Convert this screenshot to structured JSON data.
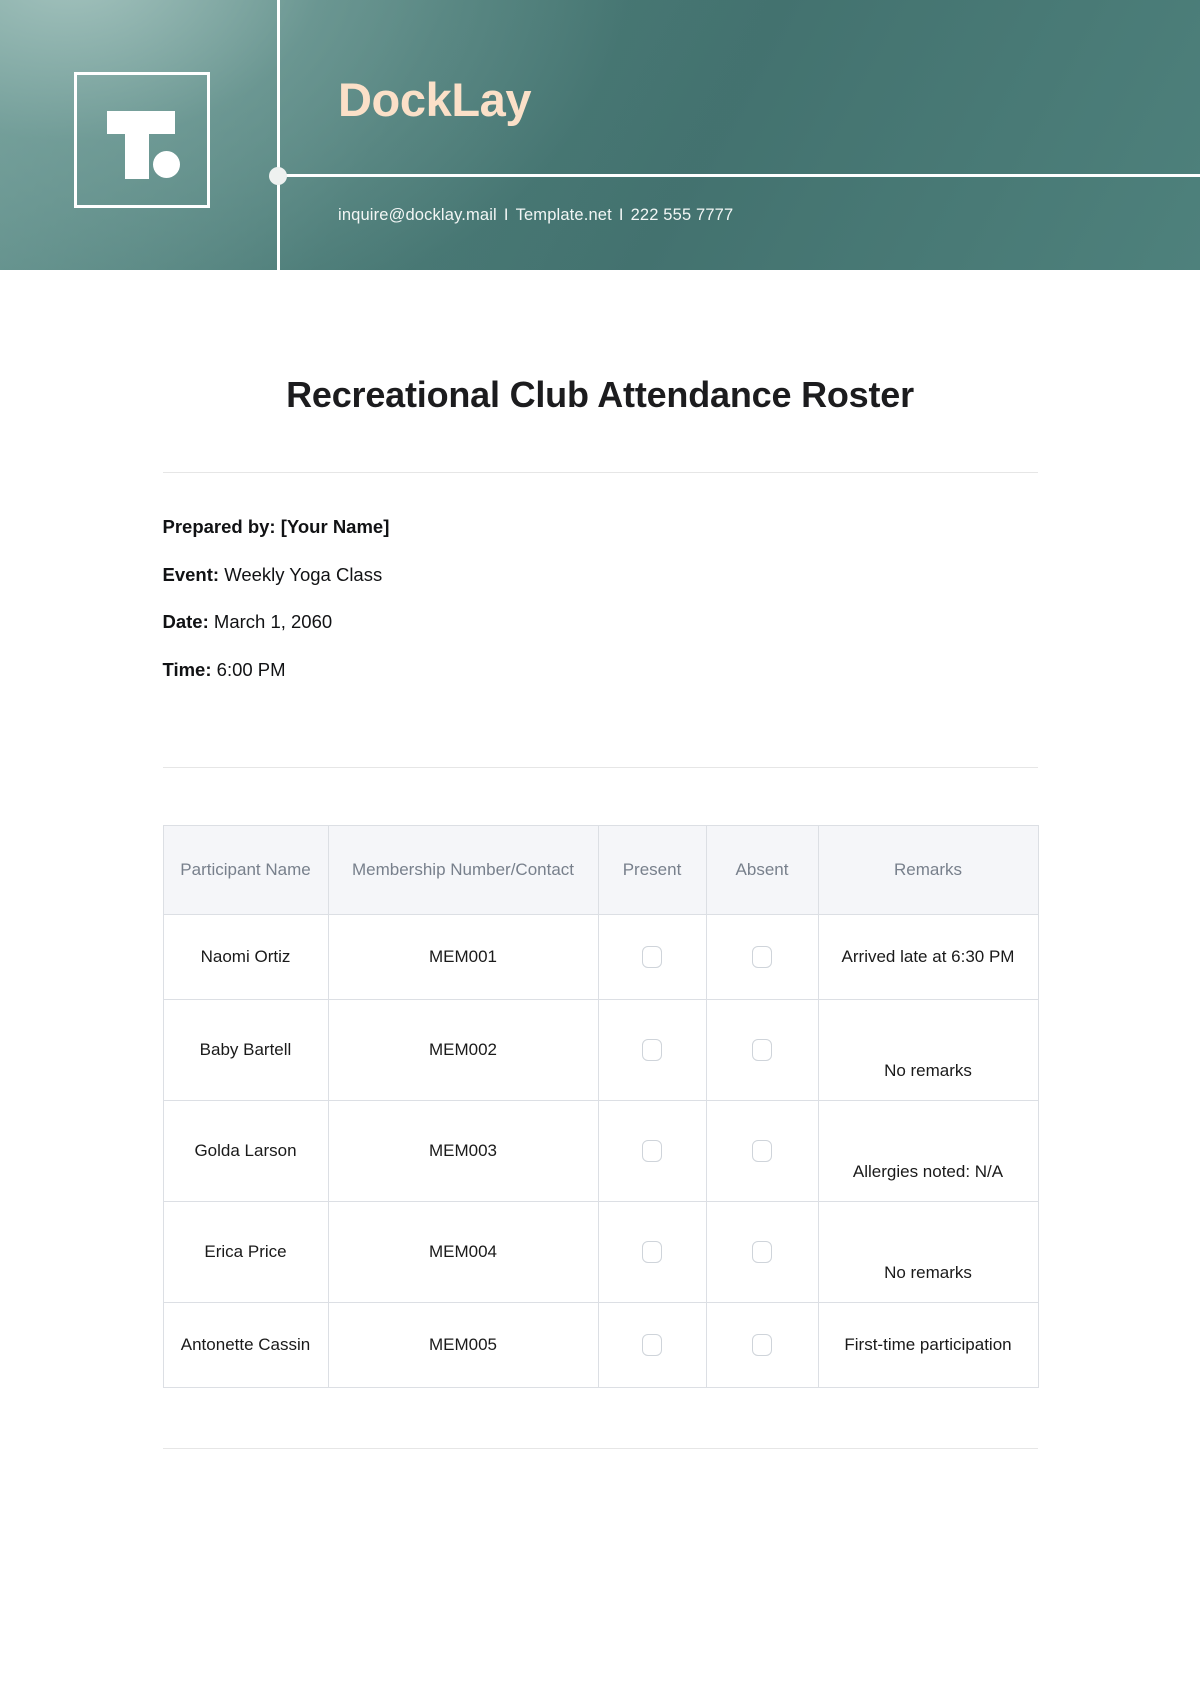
{
  "header": {
    "logo_icon": "template-t-dot-logo",
    "brand": "DockLay",
    "contact": {
      "email": "inquire@docklay.mail",
      "website": "Template.net",
      "phone": "222 555 7777",
      "separator": "I"
    },
    "colors": {
      "banner_teal": "#4a7a76",
      "banner_teal_light": "#6e9b96",
      "brand_peach": "#fbe0c8",
      "line_white": "#ffffff"
    }
  },
  "document": {
    "title": "Recreational Club Attendance Roster",
    "meta": [
      {
        "label": "Prepared by:",
        "value": "[Your Name]"
      },
      {
        "label": "Event:",
        "value": "Weekly Yoga Class"
      },
      {
        "label": "Date:",
        "value": "March 1, 2060"
      },
      {
        "label": "Time:",
        "value": "6:00 PM"
      }
    ]
  },
  "table": {
    "columns": [
      "Participant Name",
      "Membership Number/Contact",
      "Present",
      "Absent",
      "Remarks"
    ],
    "rows": [
      {
        "name": "Naomi Ortiz",
        "membership": "MEM001",
        "present": false,
        "absent": false,
        "remarks": "Arrived late at 6:30 PM"
      },
      {
        "name": "Baby Bartell",
        "membership": "MEM002",
        "present": false,
        "absent": false,
        "remarks": "No remarks"
      },
      {
        "name": "Golda Larson",
        "membership": "MEM003",
        "present": false,
        "absent": false,
        "remarks": "Allergies noted: N/A"
      },
      {
        "name": "Erica Price",
        "membership": "MEM004",
        "present": false,
        "absent": false,
        "remarks": "No remarks"
      },
      {
        "name": "Antonette Cassin",
        "membership": "MEM005",
        "present": false,
        "absent": false,
        "remarks": "First-time participation"
      }
    ]
  }
}
